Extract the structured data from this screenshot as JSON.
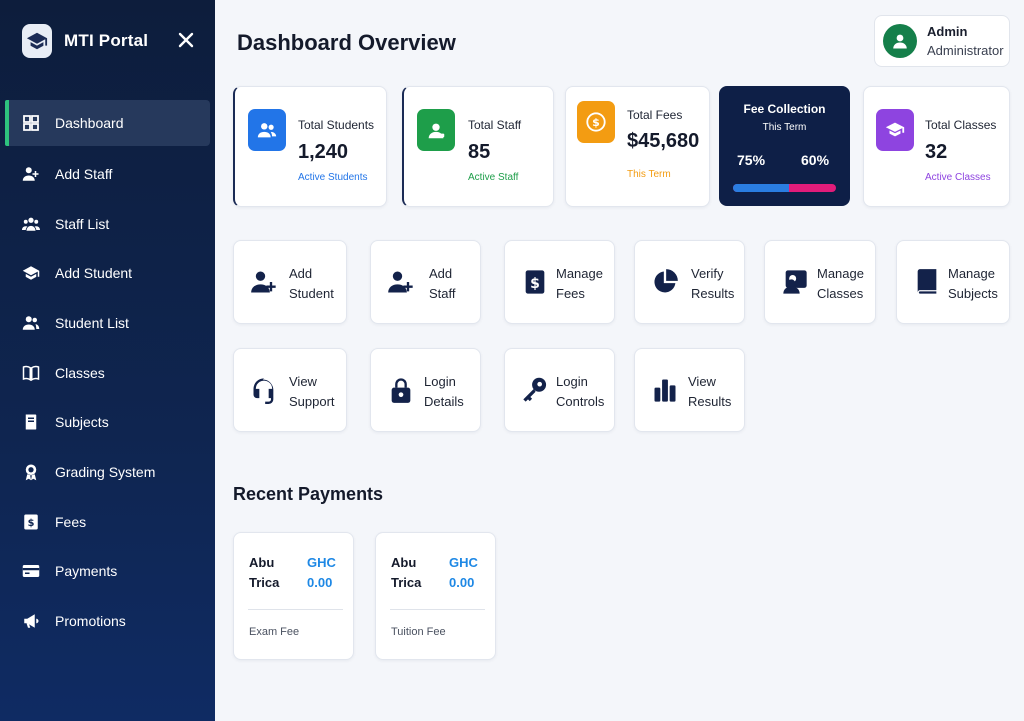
{
  "sidebar": {
    "brand": "MTI Portal",
    "items": [
      {
        "label": "Dashboard",
        "icon": "grid-icon"
      },
      {
        "label": "Add Staff",
        "icon": "user-plus-icon"
      },
      {
        "label": "Staff List",
        "icon": "users-icon"
      },
      {
        "label": "Add Student",
        "icon": "graduation-cap-icon"
      },
      {
        "label": "Student List",
        "icon": "user-group-icon"
      },
      {
        "label": "Classes",
        "icon": "book-open-icon"
      },
      {
        "label": "Subjects",
        "icon": "book-icon"
      },
      {
        "label": "Grading System",
        "icon": "award-icon"
      },
      {
        "label": "Fees",
        "icon": "dollar-icon"
      },
      {
        "label": "Payments",
        "icon": "credit-card-icon"
      },
      {
        "label": "Promotions",
        "icon": "megaphone-icon"
      }
    ]
  },
  "header": {
    "title": "Dashboard Overview",
    "user_name": "Admin",
    "user_role": "Administrator"
  },
  "stats": {
    "students": {
      "label": "Total Students",
      "value": "1,240",
      "sub": "Active Students",
      "color": "#2275e8"
    },
    "staff": {
      "label": "Total Staff",
      "value": "85",
      "sub": "Active Staff",
      "color": "#1e9e4a"
    },
    "fees": {
      "label": "Total Fees",
      "value": "$45,680",
      "sub": "This Term",
      "color": "#f39c12"
    },
    "classes": {
      "label": "Total Classes",
      "value": "32",
      "sub": "Active Classes",
      "color": "#8e44e0"
    }
  },
  "fee_collection": {
    "title": "Fee Collection",
    "subtitle": "This Term",
    "value_1": "75%",
    "value_2": "60%",
    "bar_fraction": 0.54
  },
  "actions": [
    {
      "line1": "Add",
      "line2": "Student",
      "icon": "user-plus-icon"
    },
    {
      "line1": "Add",
      "line2": "Staff",
      "icon": "user-plus-icon"
    },
    {
      "line1": "Manage",
      "line2": "Fees",
      "icon": "dollar-doc-icon"
    },
    {
      "line1": "Verify",
      "line2": "Results",
      "icon": "pie-chart-icon"
    },
    {
      "line1": "Manage",
      "line2": "Classes",
      "icon": "teacher-board-icon"
    },
    {
      "line1": "Manage",
      "line2": "Subjects",
      "icon": "book-icon"
    },
    {
      "line1": "View",
      "line2": "Support",
      "icon": "headset-icon"
    },
    {
      "line1": "Login",
      "line2": "Details",
      "icon": "lock-icon"
    },
    {
      "line1": "Login",
      "line2": "Controls",
      "icon": "key-icon"
    },
    {
      "line1": "View",
      "line2": "Results",
      "icon": "bar-chart-icon"
    }
  ],
  "recent_payments": {
    "title": "Recent Payments",
    "items": [
      {
        "name_1": "Abu",
        "name_2": "Trica",
        "amount_1": "GHC",
        "amount_2": "0.00",
        "type": "Exam Fee"
      },
      {
        "name_1": "Abu",
        "name_2": "Trica",
        "amount_1": "GHC",
        "amount_2": "0.00",
        "type": "Tuition Fee"
      }
    ]
  }
}
